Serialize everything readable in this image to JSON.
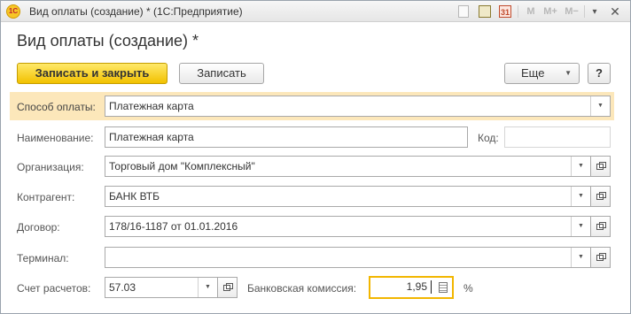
{
  "window": {
    "title": "Вид оплаты (создание) * (1С:Предприятие)",
    "logo": "1С",
    "toolbar": {
      "calendar_label": "31",
      "m_label": "M",
      "m_plus_label": "M+",
      "m_minus_label": "M−",
      "more_label": "▾",
      "close_label": "✕"
    }
  },
  "form": {
    "title": "Вид оплаты (создание) *"
  },
  "command_bar": {
    "save_close_label": "Записать и закрыть",
    "save_label": "Записать",
    "more_label": "Еще",
    "help_label": "?"
  },
  "fields": {
    "payment_method": {
      "label": "Способ оплаты:",
      "value": "Платежная карта"
    },
    "name": {
      "label": "Наименование:",
      "value": "Платежная карта"
    },
    "code": {
      "label": "Код:",
      "value": ""
    },
    "organization": {
      "label": "Организация:",
      "value": "Торговый дом \"Комплексный\""
    },
    "counterparty": {
      "label": "Контрагент:",
      "value": "БАНК ВТБ"
    },
    "contract": {
      "label": "Договор:",
      "value": "178/16-1187 от 01.01.2016"
    },
    "terminal": {
      "label": "Терминал:",
      "value": ""
    },
    "account": {
      "label": "Счет расчетов:",
      "value": "57.03"
    },
    "bank_commission": {
      "label": "Банковская комиссия:",
      "value": "1,95",
      "unit": "%"
    }
  },
  "colors": {
    "accent_yellow": "#f2c100",
    "highlight_row": "#fce7ba",
    "focus_border": "#f2b600"
  },
  "icons": {
    "dropdown": "chevron-down-icon",
    "open": "open-object-icon",
    "calculator": "calculator-icon"
  }
}
